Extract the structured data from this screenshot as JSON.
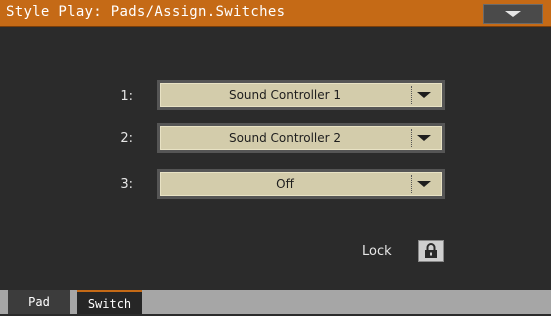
{
  "header": {
    "title": "Style Play: Pads/Assign.Switches"
  },
  "switches": [
    {
      "label": "1:",
      "value": "Sound Controller 1"
    },
    {
      "label": "2:",
      "value": "Sound Controller 2"
    },
    {
      "label": "3:",
      "value": "Off"
    }
  ],
  "lock": {
    "label": "Lock",
    "icon": "lock-icon"
  },
  "tabs": [
    {
      "label": "Pad"
    },
    {
      "label": "Switch",
      "active": true
    }
  ],
  "colors": {
    "header": "#c56a16",
    "combo_bg": "#d3ccab",
    "background": "#2b2b2b"
  }
}
